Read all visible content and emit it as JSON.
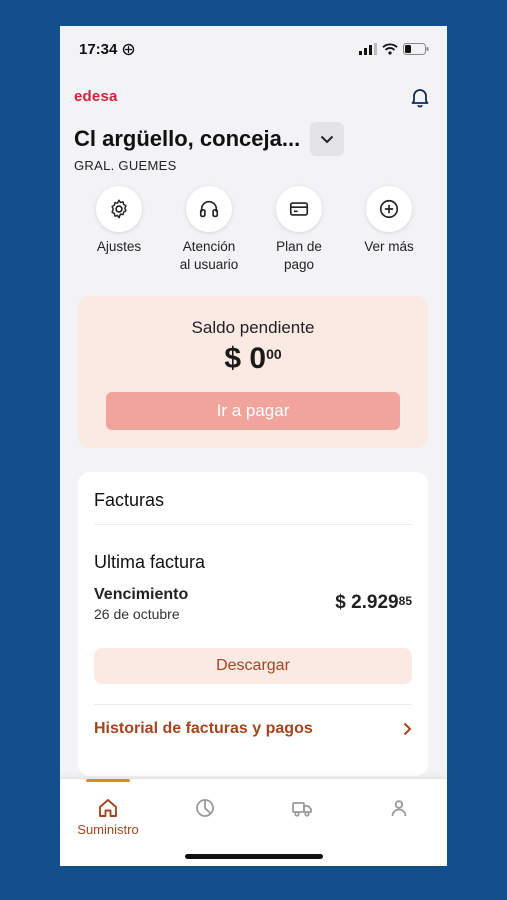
{
  "status_bar": {
    "time": "17:34"
  },
  "brand": "edesa",
  "address": {
    "title": "Cl argüello, conceja...",
    "subtitle": "GRAL. GUEMES"
  },
  "quick_actions": [
    {
      "label": "Ajustes",
      "icon": "gear-icon"
    },
    {
      "label": "Atención\nal usuario",
      "icon": "headset-icon"
    },
    {
      "label": "Plan de\npago",
      "icon": "card-icon"
    },
    {
      "label": "Ver más",
      "icon": "plus-circle-icon"
    }
  ],
  "balance": {
    "label": "Saldo pendiente",
    "amount_main": "$ 0",
    "amount_cents": "00",
    "pay_button": "Ir a pagar"
  },
  "invoices": {
    "title": "Facturas",
    "last_title": "Ultima factura",
    "due_label": "Vencimiento",
    "due_date": "26 de octubre",
    "amount_main": "$ 2.929",
    "amount_cents": "85",
    "download_button": "Descargar",
    "history_link": "Historial de facturas y pagos"
  },
  "bottom_nav": {
    "items": [
      {
        "label": "Suministro",
        "icon": "home-icon",
        "active": true
      },
      {
        "label": "",
        "icon": "pie-chart-icon",
        "active": false
      },
      {
        "label": "",
        "icon": "truck-icon",
        "active": false
      },
      {
        "label": "",
        "icon": "user-icon",
        "active": false
      }
    ]
  },
  "colors": {
    "background": "#124f8c",
    "brand": "#d3203b",
    "accent": "#a5451f",
    "card_tint": "#fbe9e4",
    "pay_button": "#f0a49b",
    "nav_active_bar": "#d98b1f"
  }
}
